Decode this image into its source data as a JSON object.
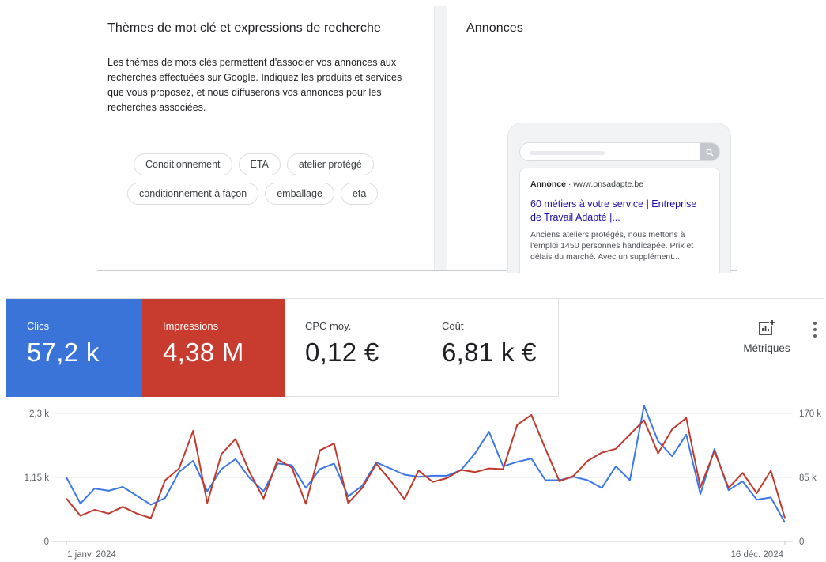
{
  "keywords": {
    "title": "Thèmes de mot clé et expressions de recherche",
    "description": "Les thèmes de mots clés permettent d'associer vos annonces aux recherches effectuées sur Google. Indiquez les produits et services que vous proposez, et nous diffuserons vos annonces pour les recherches associées.",
    "chips_row1": [
      "Conditionnement",
      "ETA",
      "atelier protégé"
    ],
    "chips_row2": [
      "conditionnement à façon",
      "emballage",
      "eta"
    ]
  },
  "ads": {
    "title": "Annonces",
    "preview": {
      "label": "Annonce",
      "separator": " · ",
      "domain": "www.onsadapte.be",
      "headline": "60 métiers à votre service | Entreprise de Travail Adapté |...",
      "description": "Anciens ateliers protégés, nous mettons à l'emploi 1450 personnes handicapée. Prix et délais du marché. Avec un supplément..."
    }
  },
  "metrics": {
    "clicks": {
      "label": "Clics",
      "value": "57,2 k",
      "color": "#3a74d8"
    },
    "impressions": {
      "label": "Impressions",
      "value": "4,38 M",
      "color": "#c83c30"
    },
    "cpc": {
      "label": "CPC moy.",
      "value": "0,12 €"
    },
    "cost": {
      "label": "Coût",
      "value": "6,81 k €"
    },
    "metrics_button": "Métriques",
    "metrics_icon": "add-chart-icon",
    "more_icon": "more-vert-icon"
  },
  "chart_data": {
    "type": "line",
    "x_start_label": "1 janv. 2024",
    "x_end_label": "16 déc. 2024",
    "y_left_ticks": [
      "0",
      "1,15 k",
      "2,3 k"
    ],
    "y_right_ticks": [
      "0",
      "85 k",
      "170 k"
    ],
    "ylim_left": [
      0,
      2300
    ],
    "ylim_right": [
      0,
      170000
    ],
    "grid": true,
    "series": [
      {
        "name": "Clics",
        "axis": "left",
        "color": "#3b78e7",
        "values": [
          1150,
          680,
          950,
          910,
          980,
          820,
          660,
          780,
          1250,
          1450,
          900,
          1300,
          1480,
          1140,
          900,
          1400,
          1370,
          960,
          1300,
          1400,
          810,
          1000,
          1420,
          1310,
          1200,
          1160,
          1180,
          1180,
          1280,
          1580,
          1970,
          1350,
          1430,
          1490,
          1100,
          1100,
          1160,
          1100,
          960,
          1350,
          1100,
          2440,
          1800,
          1530,
          1920,
          850,
          1660,
          920,
          1080,
          750,
          790,
          340
        ]
      },
      {
        "name": "Impressions",
        "axis": "right",
        "color": "#c0392b",
        "values": [
          57000,
          34000,
          42000,
          37000,
          46000,
          37000,
          31000,
          81000,
          97000,
          147000,
          51000,
          116000,
          136000,
          92000,
          57000,
          109000,
          98000,
          50000,
          121000,
          130000,
          51000,
          71000,
          103000,
          81000,
          56000,
          94000,
          79000,
          84000,
          95000,
          92000,
          97000,
          96000,
          155000,
          168000,
          123000,
          80000,
          87000,
          107000,
          118000,
          123000,
          142000,
          161000,
          117000,
          149000,
          164000,
          72000,
          120000,
          71000,
          91000,
          64000,
          94000,
          31000
        ]
      }
    ]
  }
}
